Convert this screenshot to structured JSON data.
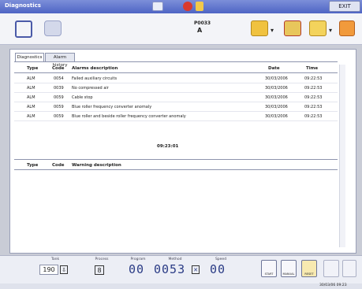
{
  "window": {
    "title": "Diagnostics",
    "exit_label": "EXIT"
  },
  "toolbar": {
    "center_label": "P0033",
    "center_sub": "A"
  },
  "tabs": [
    {
      "label": "Diagnostics"
    },
    {
      "label": "Alarm history"
    }
  ],
  "alarms": {
    "headers": {
      "type": "Type",
      "code": "Code",
      "desc": "Alarms description",
      "date": "Date",
      "time": "Time"
    },
    "rows": [
      {
        "type": "ALM",
        "code": "0054",
        "desc": "Failed auxiliary circuits",
        "date": "30/03/2006",
        "time": "09:22:53"
      },
      {
        "type": "ALM",
        "code": "0039",
        "desc": "No compressed air",
        "date": "30/03/2006",
        "time": "09:22:53"
      },
      {
        "type": "ALM",
        "code": "0059",
        "desc": "Cable stop",
        "date": "30/03/2006",
        "time": "09:22:53"
      },
      {
        "type": "ALM",
        "code": "0059",
        "desc": "Blue roller frequency converter anomaly",
        "date": "30/03/2006",
        "time": "09:22:53"
      },
      {
        "type": "ALM",
        "code": "0059",
        "desc": "Blue roller and beside roller frequency converter anomaly",
        "date": "30/03/2006",
        "time": "09:22:53"
      }
    ],
    "center_time": "09:23:01"
  },
  "warnings": {
    "headers": {
      "type": "Type",
      "code": "Code",
      "desc": "Warning description"
    }
  },
  "status": {
    "labels": {
      "tank": "Tank",
      "process": "Process",
      "program": "Program",
      "method": "Method",
      "speed": "Speed"
    },
    "tank_value": "190",
    "process_value": "8",
    "program_value": "00",
    "method_value": "0053",
    "speed_value": "00",
    "buttons": {
      "start": "START",
      "manual": "MANUAL",
      "reset": "RESET"
    }
  },
  "footer": {
    "datetime": "30/03/06 09:23"
  },
  "colors": {
    "titlebar": "#5b70cc",
    "digits": "#2a3b85"
  }
}
